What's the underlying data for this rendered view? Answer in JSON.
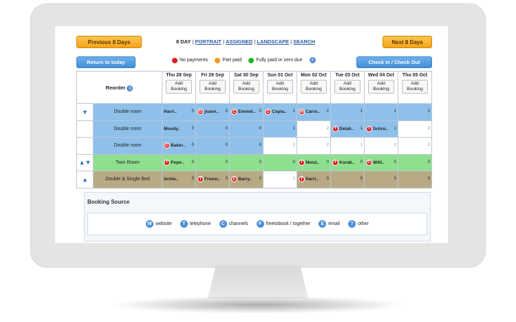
{
  "nav": {
    "prev_label": "Previous 8 Days",
    "next_label": "Next 8 Days",
    "current": "8 DAY",
    "sep": "|",
    "links": [
      "PORTRAIT",
      "ASSIGNED",
      "LANDSCAPE",
      "SEARCH"
    ],
    "today_label": "Return to today",
    "checkin_label": "Check In / Check Out"
  },
  "legend": [
    {
      "label": "No payments",
      "color": "#e02020"
    },
    {
      "label": "Part paid",
      "color": "#f39a1c"
    },
    {
      "label": "Fully paid or zero due",
      "color": "#22b422"
    }
  ],
  "legend_info": "i",
  "grid": {
    "reorder_label": "Reorder",
    "reorder_info": "i",
    "add_label": "Add Booking",
    "days": [
      "Thu 28 Sep",
      "Fri 29 Sep",
      "Sat 30 Sep",
      "Sun 01 Oct",
      "Mon 02 Oct",
      "Tue 03 Oct",
      "Wed 04 Oct",
      "Thu 05 Oct"
    ],
    "rows": [
      {
        "arrows": "▼",
        "room": "Double room",
        "color": "blue",
        "cells": [
          {
            "badge": "",
            "guest": "Harri..",
            "num": "0",
            "c": "blue"
          },
          {
            "badge": "G",
            "guest": "joann..",
            "num": "0",
            "c": "blue"
          },
          {
            "badge": "C",
            "guest": "Emmet..",
            "num": "0",
            "c": "blue"
          },
          {
            "badge": "C",
            "guest": "Copla..",
            "num": "1",
            "c": "blue"
          },
          {
            "badge": "W",
            "guest": "Carro..",
            "num": "2",
            "c": "blue"
          },
          {
            "badge": "",
            "guest": "",
            "num": "1",
            "c": "blue"
          },
          {
            "badge": "",
            "guest": "",
            "num": "1",
            "c": "blue"
          },
          {
            "badge": "",
            "guest": "",
            "num": "2",
            "c": "blue"
          }
        ]
      },
      {
        "arrows": "",
        "room": "Double room",
        "color": "blue",
        "cells": [
          {
            "badge": "",
            "guest": "Moody..",
            "num": "0",
            "c": "blue"
          },
          {
            "badge": "",
            "guest": "",
            "num": "0",
            "c": "blue"
          },
          {
            "badge": "",
            "guest": "",
            "num": "0",
            "c": "blue"
          },
          {
            "badge": "",
            "guest": "",
            "num": "1",
            "c": "blue"
          },
          {
            "badge": "",
            "guest": "",
            "num": "2",
            "c": "white"
          },
          {
            "badge": "T",
            "guest": "Delah..",
            "num": "1",
            "c": "blue"
          },
          {
            "badge": "T",
            "guest": "Schro..",
            "num": "1",
            "c": "blue"
          },
          {
            "badge": "",
            "guest": "",
            "num": "2",
            "c": "white"
          }
        ]
      },
      {
        "arrows": "",
        "room": "Double room",
        "color": "blue",
        "cells": [
          {
            "badge": "C",
            "guest": "Baker..",
            "num": "0",
            "c": "blue"
          },
          {
            "badge": "",
            "guest": "",
            "num": "0",
            "c": "blue"
          },
          {
            "badge": "",
            "guest": "",
            "num": "0",
            "c": "blue"
          },
          {
            "badge": "",
            "guest": "",
            "num": "1",
            "c": "white"
          },
          {
            "badge": "",
            "guest": "",
            "num": "2",
            "c": "white"
          },
          {
            "badge": "",
            "guest": "",
            "num": "1",
            "c": "white"
          },
          {
            "badge": "",
            "guest": "",
            "num": "1",
            "c": "white"
          },
          {
            "badge": "",
            "guest": "",
            "num": "2",
            "c": "white"
          }
        ]
      },
      {
        "arrows": "▲▼",
        "room": "Twin Room",
        "color": "green",
        "cells": [
          {
            "badge": "T",
            "guest": "Pope..",
            "num": "0",
            "c": "green"
          },
          {
            "badge": "",
            "guest": "",
            "num": "0",
            "c": "green"
          },
          {
            "badge": "",
            "guest": "",
            "num": "0",
            "c": "green"
          },
          {
            "badge": "",
            "guest": "",
            "num": "0",
            "c": "green"
          },
          {
            "badge": "T",
            "guest": "Meist..",
            "num": "0",
            "c": "green"
          },
          {
            "badge": "T",
            "guest": "Korab..",
            "num": "0",
            "c": "green"
          },
          {
            "badge": "C",
            "guest": "Willi..",
            "num": "0",
            "c": "green"
          },
          {
            "badge": "",
            "guest": "",
            "num": "0",
            "c": "green"
          }
        ]
      },
      {
        "arrows": "▲",
        "room": "Double & Single Bed",
        "color": "brown",
        "cells": [
          {
            "badge": "",
            "guest": "Schle..",
            "num": "0",
            "c": "brown"
          },
          {
            "badge": "T",
            "guest": "Freem..",
            "num": "0",
            "c": "brown"
          },
          {
            "badge": "C",
            "guest": "Barry..",
            "num": "0",
            "c": "brown"
          },
          {
            "badge": "",
            "guest": "",
            "num": "1",
            "c": "white"
          },
          {
            "badge": "T",
            "guest": "Harri..",
            "num": "0",
            "c": "brown"
          },
          {
            "badge": "",
            "guest": "",
            "num": "0",
            "c": "brown"
          },
          {
            "badge": "",
            "guest": "",
            "num": "0",
            "c": "brown"
          },
          {
            "badge": "",
            "guest": "",
            "num": "0",
            "c": "brown"
          }
        ]
      }
    ]
  },
  "booking_source": {
    "title": "Booking Source",
    "items": [
      {
        "letter": "W",
        "label": "website"
      },
      {
        "letter": "T",
        "label": "telephone"
      },
      {
        "letter": "C",
        "label": "channels"
      },
      {
        "letter": "F",
        "label": "freetobook / together"
      },
      {
        "letter": "E",
        "label": "email"
      },
      {
        "letter": "?",
        "label": "other"
      }
    ]
  }
}
